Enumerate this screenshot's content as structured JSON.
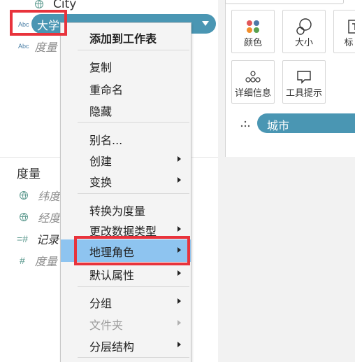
{
  "data_pane": {
    "top_field": {
      "label": "City",
      "icon": "globe-icon"
    },
    "selected_field": {
      "type_label": "Abc",
      "label": "大学"
    },
    "measure_names_field": {
      "type_label": "Abc",
      "label": "度量"
    },
    "measures_header": "度量",
    "measures": [
      {
        "icon": "globe-icon",
        "label": "纬度"
      },
      {
        "icon": "globe-icon",
        "label": "经度"
      },
      {
        "icon": "hash-icon",
        "glyph": "=#",
        "label": "记录"
      },
      {
        "icon": "hash-icon",
        "glyph": "#",
        "label": "度量"
      }
    ]
  },
  "marks": {
    "buttons": [
      {
        "label": "颜色",
        "icon": "color-dots-icon"
      },
      {
        "label": "大小",
        "icon": "size-circles-icon"
      },
      {
        "label": "标",
        "icon": "label-t-icon"
      },
      {
        "label": "详细信息",
        "icon": "detail-dots-icon"
      },
      {
        "label": "工具提示",
        "icon": "tooltip-icon"
      }
    ],
    "detail_pill": {
      "label": "城市"
    }
  },
  "context_menu": {
    "items": [
      {
        "label": "添加到工作表",
        "bold": true
      },
      {
        "label": "复制"
      },
      {
        "label": "重命名"
      },
      {
        "label": "隐藏"
      },
      {
        "label": "别名..."
      },
      {
        "label": "创建",
        "submenu": true
      },
      {
        "label": "变换",
        "submenu": true
      },
      {
        "label": "转换为度量"
      },
      {
        "label": "更改数据类型",
        "submenu": true
      },
      {
        "label": "地理角色",
        "submenu": true,
        "selected": true
      },
      {
        "label": "默认属性",
        "submenu": true
      },
      {
        "label": "分组",
        "submenu": true
      },
      {
        "label": "文件夹",
        "submenu": true,
        "disabled": true
      },
      {
        "label": "分层结构",
        "submenu": true
      }
    ]
  },
  "colors": {
    "pill": "#4a96b3",
    "menu_selected": "#8ec4f0",
    "highlight": "#e8333c"
  }
}
